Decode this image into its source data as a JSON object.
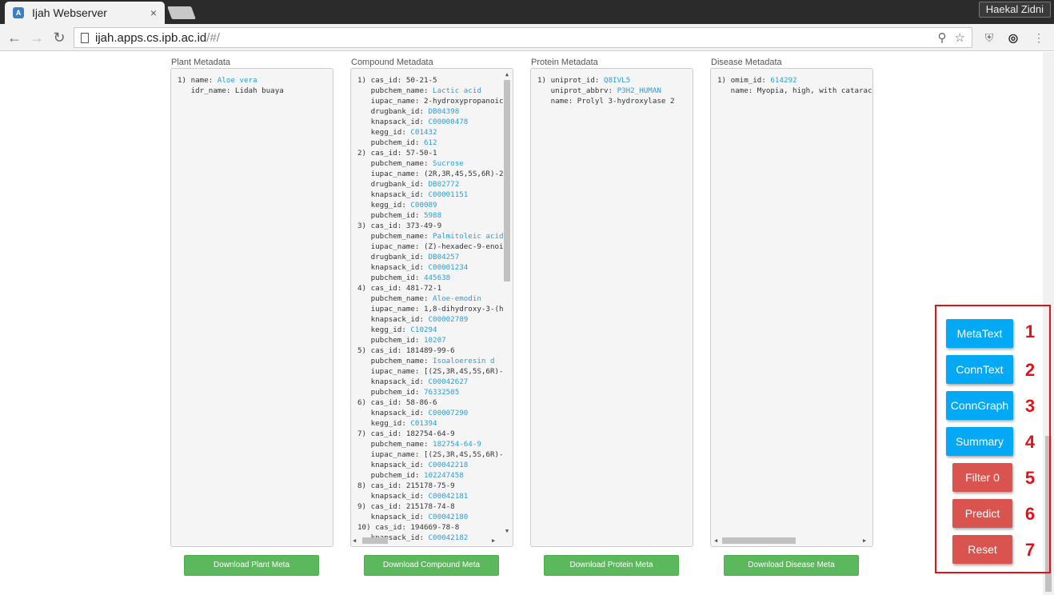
{
  "browser": {
    "tab_title": "Ijah Webserver",
    "tab_close": "×",
    "profile_name": "Haekal Zidni",
    "url_host": "ijah.apps.cs.ipb.ac.id",
    "url_path": "/#/"
  },
  "columns": {
    "plant": {
      "title": "Plant Metadata",
      "download_label": "Download Plant Meta",
      "lines": [
        {
          "k": "1) name: ",
          "v": "Aloe vera"
        },
        {
          "k": "   idr_name: Lidah buaya",
          "v": ""
        }
      ]
    },
    "compound": {
      "title": "Compound Metadata",
      "download_label": "Download Compound Meta",
      "lines": [
        {
          "k": "1) cas_id: 50-21-5",
          "v": ""
        },
        {
          "k": "   pubchem_name: ",
          "v": "Lactic acid"
        },
        {
          "k": "   iupac_name: 2-hydroxypropanoic",
          "v": ""
        },
        {
          "k": "   drugbank_id: ",
          "v": "DB04398"
        },
        {
          "k": "   knapsack_id: ",
          "v": "C00000478"
        },
        {
          "k": "   kegg_id: ",
          "v": "C01432"
        },
        {
          "k": "   pubchem_id: ",
          "v": "612"
        },
        {
          "k": "2) cas_id: 57-50-1",
          "v": ""
        },
        {
          "k": "   pubchem_name: ",
          "v": "Sucrose"
        },
        {
          "k": "   iupac_name: (2R,3R,4S,5S,6R)-2",
          "v": ""
        },
        {
          "k": "   drugbank_id: ",
          "v": "DB02772"
        },
        {
          "k": "   knapsack_id: ",
          "v": "C00001151"
        },
        {
          "k": "   kegg_id: ",
          "v": "C00089"
        },
        {
          "k": "   pubchem_id: ",
          "v": "5988"
        },
        {
          "k": "3) cas_id: 373-49-9",
          "v": ""
        },
        {
          "k": "   pubchem_name: ",
          "v": "Palmitoleic acid"
        },
        {
          "k": "   iupac_name: (Z)-hexadec-9-enoi",
          "v": ""
        },
        {
          "k": "   drugbank_id: ",
          "v": "DB04257"
        },
        {
          "k": "   knapsack_id: ",
          "v": "C00001234"
        },
        {
          "k": "   pubchem_id: ",
          "v": "445638"
        },
        {
          "k": "4) cas_id: 481-72-1",
          "v": ""
        },
        {
          "k": "   pubchem_name: ",
          "v": "Aloe-emodin"
        },
        {
          "k": "   iupac_name: 1,8-dihydroxy-3-(h",
          "v": ""
        },
        {
          "k": "   knapsack_id: ",
          "v": "C00002789"
        },
        {
          "k": "   kegg_id: ",
          "v": "C10294"
        },
        {
          "k": "   pubchem_id: ",
          "v": "10207"
        },
        {
          "k": "5) cas_id: 181489-99-6",
          "v": ""
        },
        {
          "k": "   pubchem_name: ",
          "v": "Isoaloeresin d"
        },
        {
          "k": "   iupac_name: [(2S,3R,4S,5S,6R)-",
          "v": ""
        },
        {
          "k": "   knapsack_id: ",
          "v": "C00042627"
        },
        {
          "k": "   pubchem_id: ",
          "v": "76332505"
        },
        {
          "k": "6) cas_id: 58-86-6",
          "v": ""
        },
        {
          "k": "   knapsack_id: ",
          "v": "C00007290"
        },
        {
          "k": "   kegg_id: ",
          "v": "C01394"
        },
        {
          "k": "7) cas_id: 182754-64-9",
          "v": ""
        },
        {
          "k": "   pubchem_name: ",
          "v": "182754-64-9"
        },
        {
          "k": "   iupac_name: [(2S,3R,4S,5S,6R)-",
          "v": ""
        },
        {
          "k": "   knapsack_id: ",
          "v": "C00042218"
        },
        {
          "k": "   pubchem_id: ",
          "v": "102247458"
        },
        {
          "k": "8) cas_id: 215178-75-9",
          "v": ""
        },
        {
          "k": "   knapsack_id: ",
          "v": "C00042181"
        },
        {
          "k": "9) cas_id: 215178-74-8",
          "v": ""
        },
        {
          "k": "   knapsack_id: ",
          "v": "C00042180"
        },
        {
          "k": "10) cas_id: 194669-78-8",
          "v": ""
        },
        {
          "k": "   knapsack_id: ",
          "v": "C00042182"
        }
      ]
    },
    "protein": {
      "title": "Protein Metadata",
      "download_label": "Download Protein Meta",
      "lines": [
        {
          "k": "1) uniprot_id: ",
          "v": "Q8IVL5"
        },
        {
          "k": "   uniprot_abbrv: ",
          "v": "P3H2_HUMAN"
        },
        {
          "k": "   name: Prolyl 3-hydroxylase 2",
          "v": ""
        }
      ]
    },
    "disease": {
      "title": "Disease Metadata",
      "download_label": "Download Disease Meta",
      "lines": [
        {
          "k": "1) omim_id: ",
          "v": "614292"
        },
        {
          "k": "   name: Myopia, high, with cataract",
          "v": ""
        }
      ]
    }
  },
  "side_panel": {
    "buttons": [
      {
        "label": "MetaText",
        "number": "1"
      },
      {
        "label": "ConnText",
        "number": "2"
      },
      {
        "label": "ConnGraph",
        "number": "3"
      },
      {
        "label": "Summary",
        "number": "4"
      },
      {
        "label": "Filter 0",
        "number": "5"
      },
      {
        "label": "Predict",
        "number": "6"
      },
      {
        "label": "Reset",
        "number": "7"
      }
    ]
  },
  "colors": {
    "link_value": "#2a9fd6",
    "download_green": "#5cb85c",
    "side_blue": "#03a9f4",
    "side_red": "#d9534f",
    "annotation_red": "#e3121a"
  }
}
